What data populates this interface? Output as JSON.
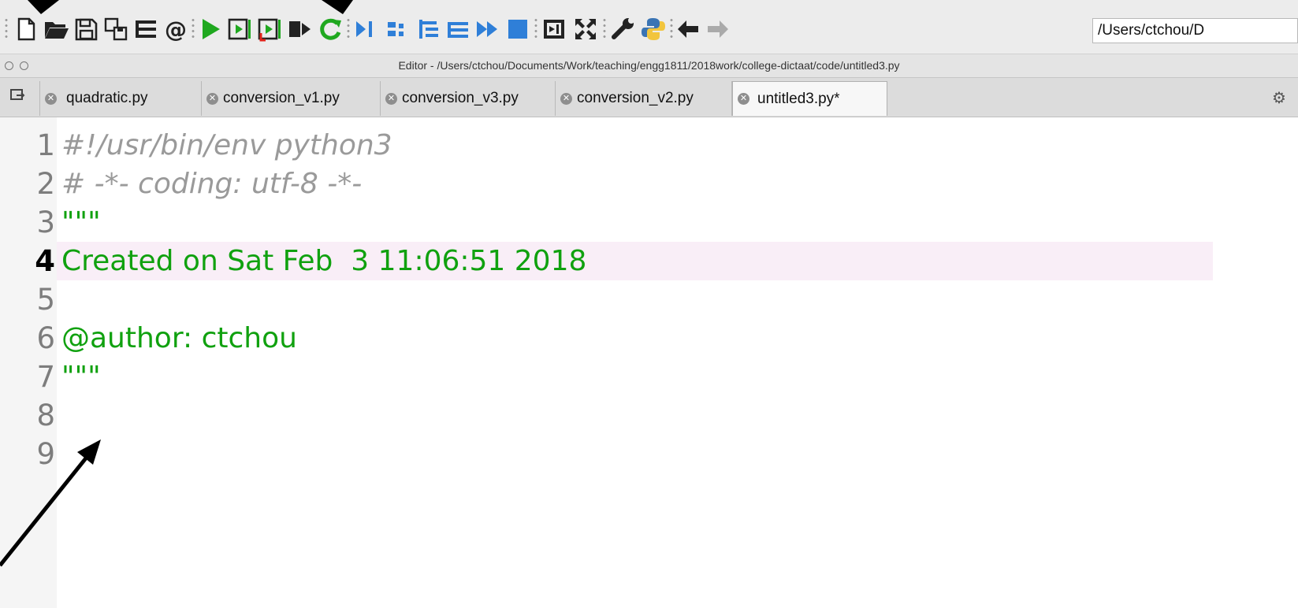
{
  "toolbar": {
    "icons": [
      "new-file-icon",
      "open-folder-icon",
      "save-icon",
      "save-all-icon",
      "list-icon",
      "at-icon",
      "run-icon",
      "run-cell-icon",
      "run-cell-advance-icon",
      "run-selection-icon",
      "rerun-icon",
      "debug-icon",
      "step-icon",
      "step-into-icon",
      "step-return-icon",
      "continue-icon",
      "stop-icon",
      "maximize-pane-icon",
      "fullscreen-icon",
      "wrench-icon",
      "python-icon",
      "back-arrow-icon",
      "forward-arrow-icon"
    ],
    "path": "/Users/ctchou/D"
  },
  "editor_window": {
    "title": "Editor - /Users/ctchou/Documents/Work/teaching/engg1811/2018work/college-dictaat/code/untitled3.py"
  },
  "tabs": [
    {
      "label": "quadratic.py",
      "active": false
    },
    {
      "label": "conversion_v1.py",
      "active": false
    },
    {
      "label": "conversion_v3.py",
      "active": false
    },
    {
      "label": "conversion_v2.py",
      "active": false
    },
    {
      "label": "untitled3.py*",
      "active": true
    }
  ],
  "code_lines": [
    {
      "num": "1",
      "text": "#!/usr/bin/env python3",
      "style": "comment"
    },
    {
      "num": "2",
      "text": "# -*- coding: utf-8 -*-",
      "style": "comment"
    },
    {
      "num": "3",
      "text": "\"\"\"",
      "style": "string"
    },
    {
      "num": "4",
      "text": "Created on Sat Feb  3 11:06:51 2018",
      "style": "string",
      "current": true
    },
    {
      "num": "5",
      "text": "",
      "style": "string"
    },
    {
      "num": "6",
      "text": "@author: ctchou",
      "style": "string"
    },
    {
      "num": "7",
      "text": "\"\"\"",
      "style": "string"
    },
    {
      "num": "8",
      "text": "",
      "style": "plain"
    },
    {
      "num": "9",
      "text": "",
      "style": "plain"
    }
  ],
  "colors": {
    "string": "#10a10f",
    "comment": "#9a9a9a",
    "current_line": "#f9eef7",
    "run_green": "#1fa81f",
    "debug_blue": "#2f7fd8"
  }
}
